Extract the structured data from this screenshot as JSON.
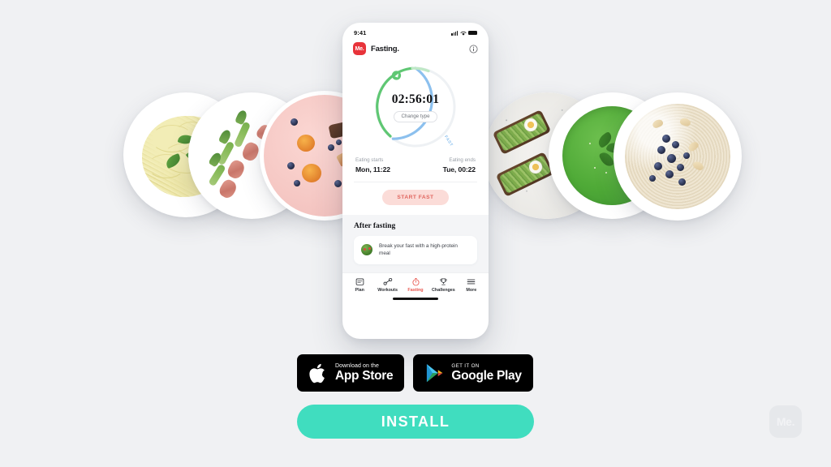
{
  "background_color": "#f0f1f3",
  "phone": {
    "status_bar": {
      "time": "9:41",
      "signal_icon": "cellular-bars-icon",
      "wifi_icon": "wifi-icon",
      "battery_icon": "battery-icon"
    },
    "app_bar": {
      "logo_text": "Me.",
      "title": "Fasting.",
      "info_icon": "info-circle-icon",
      "logo_color": "#e8333a"
    },
    "timer": {
      "value": "02:56:01",
      "change_type_label": "Change type",
      "fast_arc_label": "FAST",
      "eating_arc_color": "#5fc773",
      "fasting_arc_color": "#8cc0ee",
      "progress_marker_icon": "progress-marker-icon"
    },
    "schedule": {
      "eating_starts_label": "Eating starts",
      "eating_starts_value": "Mon, 11:22",
      "eating_ends_label": "Eating ends",
      "eating_ends_value": "Tue, 00:22"
    },
    "start_button": {
      "label": "START FAST",
      "bg": "#fbdcd8",
      "fg": "#e0655e"
    },
    "after_fasting": {
      "title": "After fasting",
      "tip_icon": "avocado-bowl-icon",
      "tip_text": "Break your fast with a high-protein meal"
    },
    "tabbar": {
      "items": [
        {
          "label": "Plan",
          "icon": "plan-calendar-icon",
          "active": false
        },
        {
          "label": "Workouts",
          "icon": "dumbbell-icon",
          "active": false
        },
        {
          "label": "Fasting",
          "icon": "stopwatch-icon",
          "active": true
        },
        {
          "label": "Challenges",
          "icon": "trophy-icon",
          "active": false
        },
        {
          "label": "More",
          "icon": "hamburger-menu-icon",
          "active": false
        }
      ],
      "active_color": "#e8554d"
    },
    "home_indicator": "home-indicator"
  },
  "plates": [
    {
      "name": "pasta-pesto-plate",
      "dish": "Pasta with pesto and basil"
    },
    {
      "name": "asparagus-bacon-plate",
      "dish": "Bacon-wrapped asparagus"
    },
    {
      "name": "pink-dessert-plate",
      "dish": "Tartlets with blueberries"
    },
    {
      "name": "avocado-toast-plate",
      "dish": "Avocado toast with egg"
    },
    {
      "name": "green-soup-plate",
      "dish": "Green spinach soup"
    },
    {
      "name": "oatmeal-blueberry-plate",
      "dish": "Oatmeal with blueberries and almonds"
    }
  ],
  "store_buttons": {
    "app_store": {
      "sub": "Download on the",
      "main": "App Store",
      "icon": "apple-logo-icon"
    },
    "google_play": {
      "sub": "GET IT ON",
      "main": "Google Play",
      "icon": "google-play-triangle-icon"
    }
  },
  "install_button": {
    "label": "INSTALL",
    "color": "#40ddbf"
  },
  "watermark": {
    "label": "Me."
  }
}
